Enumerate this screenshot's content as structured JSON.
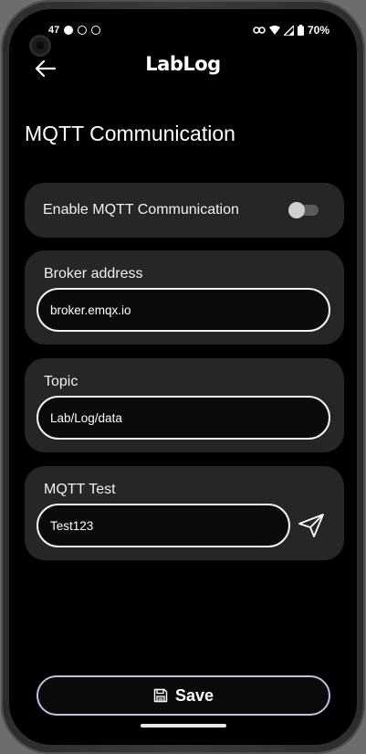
{
  "status_bar": {
    "time": "47",
    "battery": "70%"
  },
  "app_bar": {
    "title": "LabLog",
    "back_icon": "arrow-left-icon"
  },
  "page": {
    "title": "MQTT Communication"
  },
  "toggle": {
    "label": "Enable MQTT Communication",
    "enabled": false
  },
  "broker": {
    "label": "Broker address",
    "value": "broker.emqx.io"
  },
  "topic": {
    "label": "Topic",
    "value": "Lab/Log/data"
  },
  "test": {
    "label": "MQTT Test",
    "value": "Test123",
    "send_icon": "send-icon"
  },
  "save": {
    "label": "Save",
    "icon": "floppy-disk-icon"
  },
  "colors": {
    "background": "#000000",
    "card": "#262626",
    "accent_border": "#c8bce8",
    "input_border": "#f2f2f2"
  }
}
